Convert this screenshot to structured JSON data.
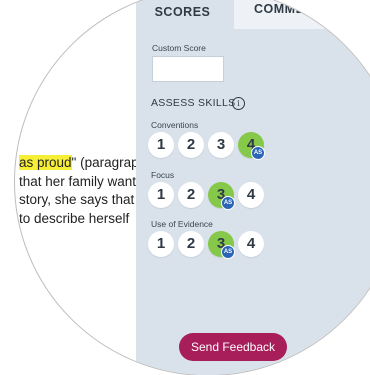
{
  "tabs": {
    "scores": "SCORES",
    "comments": "COMMENTS"
  },
  "document": {
    "highlight": "as proud",
    "line1_rest": "\" (paragraph",
    "line2": "that her family wants",
    "line3": "story, she says that",
    "line4": "to describe herself"
  },
  "custom_score": {
    "label": "Custom Score",
    "value": ""
  },
  "assess": {
    "title": "ASSESS SKILLS",
    "info_icon": "i"
  },
  "skills": [
    {
      "name": "Conventions",
      "scores": [
        "1",
        "2",
        "3",
        "4"
      ],
      "selected": "4",
      "badge": "AS"
    },
    {
      "name": "Focus",
      "scores": [
        "1",
        "2",
        "3",
        "4"
      ],
      "selected": "3",
      "badge": "AS"
    },
    {
      "name": "Use of Evidence",
      "scores": [
        "1",
        "2",
        "3",
        "4"
      ],
      "selected": "3",
      "badge": "AS"
    }
  ],
  "send_button": "Send Feedback",
  "colors": {
    "panel": "#d9e1ea",
    "selected": "#86c84a",
    "badge": "#2a65b8",
    "send": "#a81e5a",
    "highlight": "#f7ee36"
  }
}
